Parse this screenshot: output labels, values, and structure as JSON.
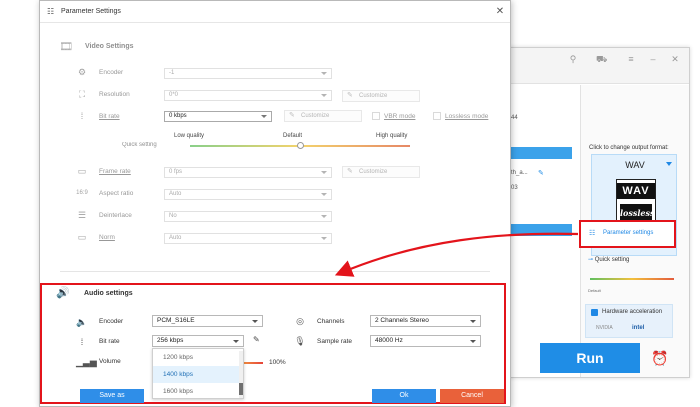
{
  "dialog": {
    "title": "Parameter Settings",
    "close_glyph": "✕"
  },
  "video": {
    "section_title": "Video Settings",
    "encoder": {
      "label": "Encoder",
      "value": "-1"
    },
    "resolution": {
      "label": "Resolution",
      "value": "0*0",
      "customize": "Customize"
    },
    "bitrate": {
      "label": "Bit rate",
      "value": "0 kbps",
      "customize": "Customize",
      "vbr_label": "VBR mode",
      "lossless_label": "Lossless mode"
    },
    "quick_setting": {
      "label": "Quick setting",
      "low": "Low quality",
      "default": "Default",
      "high": "High quality",
      "level": 0.5
    },
    "framerate": {
      "label": "Frame rate",
      "value": "0 fps",
      "customize": "Customize"
    },
    "aspect": {
      "label": "Aspect ratio",
      "value": "Auto"
    },
    "deinterlace": {
      "label": "Deinterlace",
      "value": "No"
    },
    "norm": {
      "label": "Norm",
      "value": "Auto"
    }
  },
  "audio": {
    "section_title": "Audio settings",
    "encoder": {
      "label": "Encoder",
      "value": "PCM_S16LE"
    },
    "channels": {
      "label": "Channels",
      "value": "2 Channels Stereo"
    },
    "bitrate": {
      "label": "Bit rate",
      "value": "256 kbps"
    },
    "sample_rate": {
      "label": "Sample rate",
      "value": "48000 Hz"
    },
    "volume": {
      "label": "Volume",
      "value": "100%",
      "level": 1.0
    },
    "bitrate_options": [
      "1200 kbps",
      "1400 kbps",
      "1600 kbps"
    ],
    "bitrate_highlighted": "1400 kbps"
  },
  "footer": {
    "save_as": "Save as",
    "ok": "Ok",
    "cancel": "Cancel"
  },
  "background_app": {
    "list_rows": [
      {
        "text": "44"
      },
      {
        "text": "th_a..."
      },
      {
        "text": "03"
      }
    ],
    "format_caption": "Click to change output format:",
    "format_name": "WAV",
    "wav_badge": "WAV",
    "lossless_logo": "lossless",
    "lossless_sub": "Lossless Audio",
    "param_button": "Parameter settings",
    "quick_setting": "Quick setting",
    "quick_default": "Default",
    "hw_accel": "Hardware acceleration",
    "nvidia": "NVIDIA",
    "intel": "intel",
    "run": "Run"
  },
  "colors": {
    "highlight_red": "#e3141b",
    "accent_blue": "#1f8de6",
    "cancel_orange": "#e9613a"
  }
}
